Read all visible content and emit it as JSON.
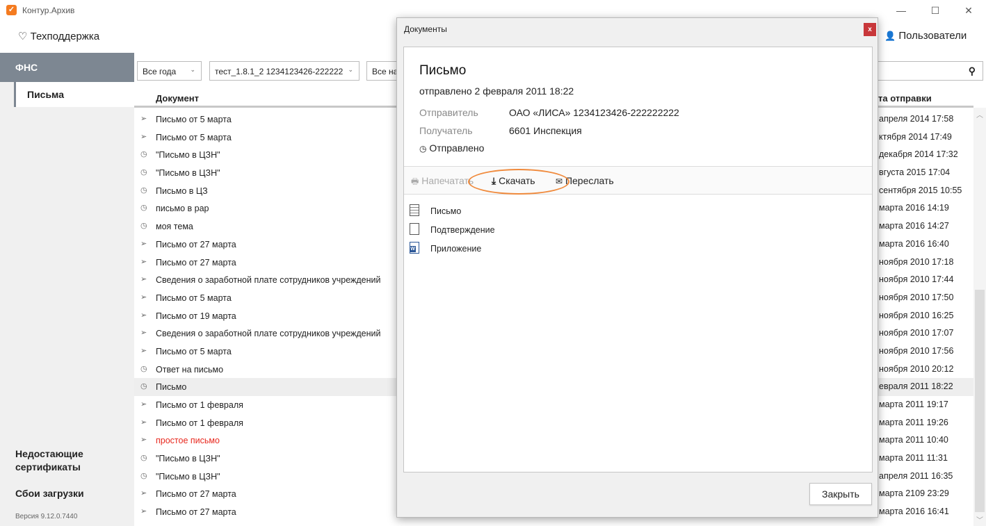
{
  "app": {
    "title": "Контур.Архив",
    "logo_glyph": "✓"
  },
  "window_controls": {
    "minimize": "—",
    "maximize": "☐",
    "close": "✕"
  },
  "topbar": {
    "support_label": "Техподдержка",
    "users_label": "Пользователи"
  },
  "sidebar": {
    "section": "ФНС",
    "active_item": "Письма",
    "missing_certs": "Недостающие сертификаты",
    "load_failures": "Сбои загрузки",
    "version": "Версия 9.12.0.7440"
  },
  "filters": {
    "year": "Все года",
    "org": "тест_1.8.1_2 1234123426-222222",
    "third": "Все на"
  },
  "table": {
    "col_document": "Документ",
    "col_date": "та отправки",
    "rows": [
      {
        "icon": "sent",
        "title": "Письмо от 5 марта",
        "date": "апреля 2014 17:58"
      },
      {
        "icon": "sent",
        "title": "Письмо от 5 марта",
        "date": "ктября 2014 17:49"
      },
      {
        "icon": "clock",
        "title": "\"Письмо в ЦЗН\"",
        "date": "декабря 2014 17:32"
      },
      {
        "icon": "clock",
        "title": "\"Письмо в ЦЗН\"",
        "date": "вгуста 2015 17:04"
      },
      {
        "icon": "clock",
        "title": "Письмо в ЦЗ",
        "date": "сентября 2015 10:55"
      },
      {
        "icon": "clock",
        "title": "письмо в рар",
        "date": "марта 2016 14:19"
      },
      {
        "icon": "clock",
        "title": "моя тема",
        "date": "марта 2016 14:27"
      },
      {
        "icon": "sent",
        "title": "Письмо от 27 марта",
        "date": "марта 2016 16:40"
      },
      {
        "icon": "sent",
        "title": "Письмо от 27 марта",
        "date": "ноября 2010 17:18"
      },
      {
        "icon": "sent",
        "title": "Сведения о заработной плате сотрудников учреждений",
        "date": "ноября 2010 17:44"
      },
      {
        "icon": "sent",
        "title": "Письмо от 5 марта",
        "date": "ноября 2010 17:50"
      },
      {
        "icon": "sent",
        "title": "Письмо от 19 марта",
        "date": "ноября 2010 16:25"
      },
      {
        "icon": "sent",
        "title": "Сведения о заработной плате сотрудников учреждений",
        "date": "ноября 2010 17:07"
      },
      {
        "icon": "sent",
        "title": "Письмо от 5 марта",
        "date": "ноября 2010 17:56"
      },
      {
        "icon": "clock",
        "title": "Ответ на письмо",
        "date": "ноября 2010 20:12"
      },
      {
        "icon": "clock",
        "title": "Письмо",
        "date": "евраля 2011 18:22",
        "selected": true
      },
      {
        "icon": "sent",
        "title": "Письмо от 1 февраля",
        "date": "марта 2011 19:17"
      },
      {
        "icon": "sent",
        "title": "Письмо от 1 февраля",
        "date": "марта 2011 19:26"
      },
      {
        "icon": "sent",
        "title": "простое письмо",
        "date": "марта 2011 10:40",
        "red": true
      },
      {
        "icon": "clock",
        "title": "\"Письмо в ЦЗН\"",
        "date": "марта 2011 11:31"
      },
      {
        "icon": "clock",
        "title": "\"Письмо в ЦЗН\"",
        "date": "апреля 2011 16:35"
      },
      {
        "icon": "sent",
        "title": "Письмо от 27 марта",
        "date": "марта 2109 23:29"
      },
      {
        "icon": "sent",
        "title": "Письмо от 27 марта",
        "date": "марта 2016 16:41"
      }
    ]
  },
  "dialog": {
    "title": "Документы",
    "close_glyph": "x",
    "doc_title": "Письмо",
    "doc_sent": "отправлено 2 февраля 2011 18:22",
    "sender_label": "Отправитель",
    "sender_value": "ОАО «ЛИСА» 1234123426-222222222",
    "recipient_label": "Получатель",
    "recipient_value": "6601 Инспекция",
    "status": "Отправлено",
    "actions": {
      "print": "Напечатать",
      "download": "Скачать",
      "forward": "Переслать"
    },
    "files": [
      {
        "type": "doc",
        "name": "Письмо"
      },
      {
        "type": "blank",
        "name": "Подтверждение"
      },
      {
        "type": "word",
        "name": "Приложение"
      }
    ],
    "close_button": "Закрыть"
  },
  "colors": {
    "accent": "#f47b20",
    "sidebar_active": "#7d8792",
    "highlight": "#f08a3c",
    "red_text": "#e8281e"
  }
}
